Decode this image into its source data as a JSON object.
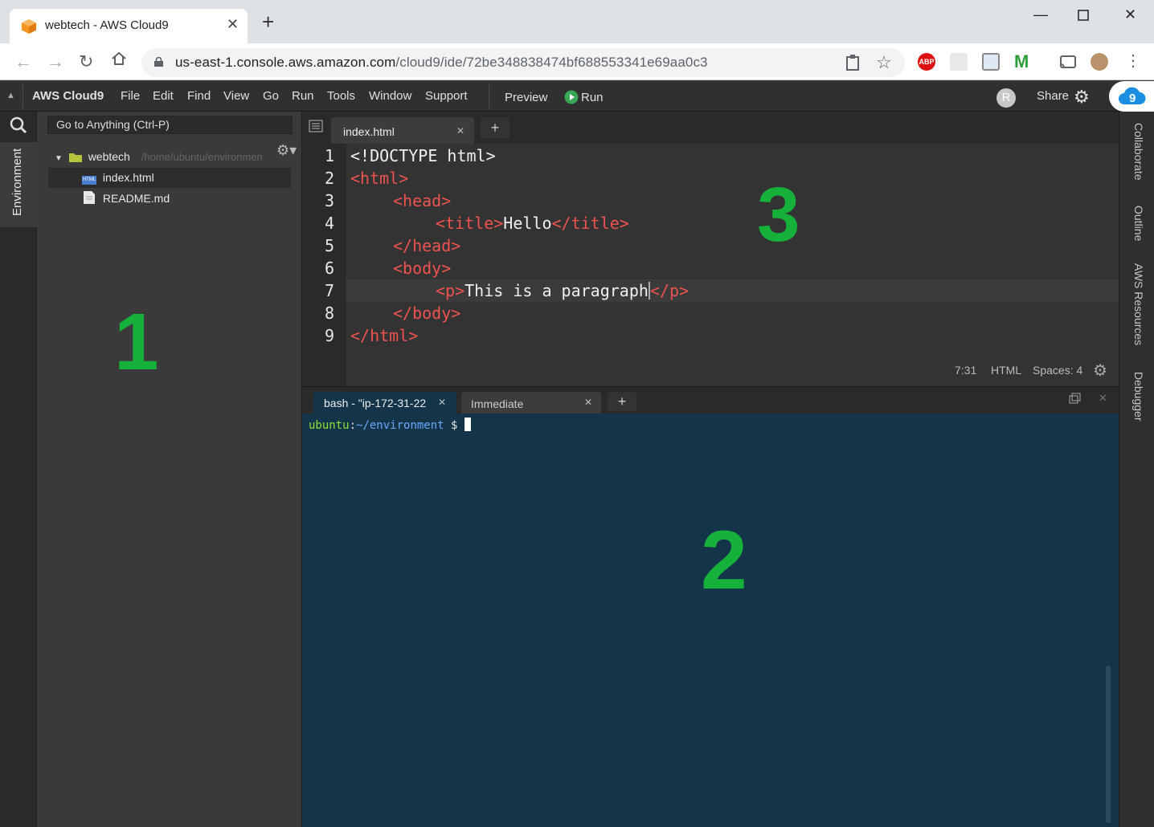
{
  "browser": {
    "tab_title": "webtech - AWS Cloud9",
    "url_host": "us-east-1.console.aws.amazon.com",
    "url_path": "/cloud9/ide/72be348838474bf688553341e69aa0c3",
    "extension_abp": "ABP"
  },
  "menubar": {
    "brand": "AWS Cloud9",
    "items": [
      "File",
      "Edit",
      "Find",
      "View",
      "Go",
      "Run",
      "Tools",
      "Window",
      "Support"
    ],
    "preview": "Preview",
    "run": "Run",
    "avatar_letter": "R",
    "share": "Share"
  },
  "sidebar": {
    "env_tab": "Environment",
    "goto_placeholder": "Go to Anything (Ctrl-P)",
    "root_folder": "webtech",
    "root_path": "/home/ubuntu/environmen",
    "files": [
      "index.html",
      "README.md"
    ],
    "file_icon_html": "HTML"
  },
  "editor": {
    "tab_label": "index.html",
    "line_numbers": [
      "1",
      "2",
      "3",
      "4",
      "5",
      "6",
      "7",
      "8",
      "9"
    ],
    "lines": [
      {
        "tag_open": "",
        "text": "<!DOCTYPE html>",
        "tag_close": ""
      },
      {
        "tag_open": "<html>",
        "text": "",
        "tag_close": ""
      },
      {
        "tag_open": "<head>",
        "text": "",
        "tag_close": ""
      },
      {
        "tag_open": "<title>",
        "text": "Hello",
        "tag_close": "</title>"
      },
      {
        "tag_open": "</head>",
        "text": "",
        "tag_close": ""
      },
      {
        "tag_open": "<body>",
        "text": "",
        "tag_close": ""
      },
      {
        "tag_open": "<p>",
        "text": "This is a paragraph",
        "tag_close": "</p>"
      },
      {
        "tag_open": "</body>",
        "text": "",
        "tag_close": ""
      },
      {
        "tag_open": "</html>",
        "text": "",
        "tag_close": ""
      }
    ],
    "status_position": "7:31",
    "status_mode": "HTML",
    "status_spaces": "Spaces: 4"
  },
  "terminal": {
    "tab_bash": "bash - \"ip-172-31-22",
    "tab_immediate": "Immediate",
    "prompt_user": "ubuntu",
    "prompt_path": "~/environment",
    "prompt_symbol": "$"
  },
  "right_panel": [
    "Collaborate",
    "Outline",
    "AWS Resources",
    "Debugger"
  ],
  "annotations": {
    "one": "1",
    "two": "2",
    "three": "3"
  },
  "colors": {
    "accent_green": "#16b13a",
    "tag_red": "#ef5350",
    "terminal_bg": "#14344a"
  }
}
